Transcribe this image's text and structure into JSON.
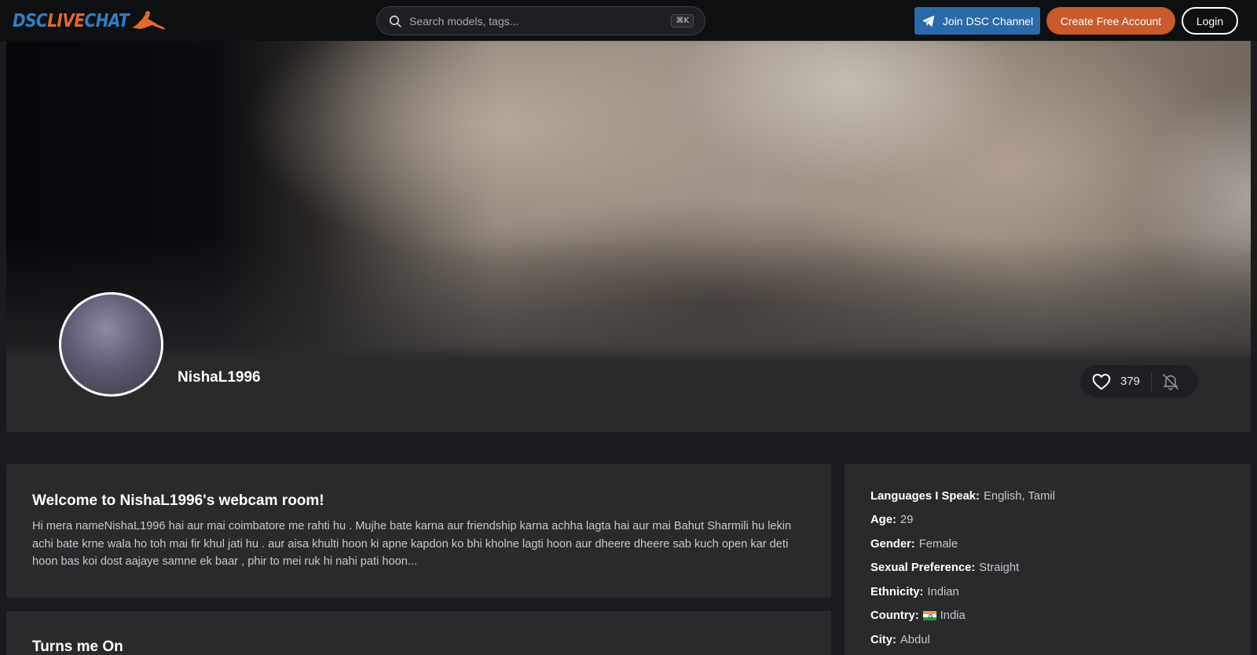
{
  "header": {
    "logo_prefix": "DSC",
    "logo_highlight": "LIVE",
    "logo_suffix": "CHAT",
    "search": {
      "placeholder": "Search models, tags...",
      "shortcut": "⌘K"
    },
    "telegram_label": "Join DSC Channel",
    "create_label": "Create Free Account",
    "login_label": "Login"
  },
  "profile": {
    "username": "NishaL1996",
    "likes": "379"
  },
  "about": {
    "title": "Welcome to NishaL1996's webcam room!",
    "text": "Hi mera nameNishaL1996 hai aur mai coimbatore me rahti hu . Mujhe bate karna aur friendship karna achha lagta hai aur mai Bahut Sharmili hu lekin achi bate krne wala ho toh mai fir khul jati hu . aur aisa khulti hoon ki apne kapdon ko bhi kholne lagti hoon aur dheere dheere sab kuch open kar deti hoon bas koi dost aajaye samne ek baar , phir to mei ruk hi nahi pati hoon..."
  },
  "turns_on": {
    "title": "Turns me On"
  },
  "info": [
    {
      "key": "Languages I Speak:",
      "value": "English, Tamil"
    },
    {
      "key": "Age:",
      "value": "29"
    },
    {
      "key": "Gender:",
      "value": "Female"
    },
    {
      "key": "Sexual Preference:",
      "value": "Straight"
    },
    {
      "key": "Ethnicity:",
      "value": "Indian"
    },
    {
      "key": "Country:",
      "value": "India",
      "flag": "india-flag-icon"
    },
    {
      "key": "City:",
      "value": "Abdul"
    }
  ],
  "colors": {
    "brand_blue": "#2f7fc6",
    "brand_orange": "#e06a2c",
    "telegram_button": "#2b6aa8",
    "create_button": "#c85a2c",
    "page_bg": "#1a1b1e",
    "card_bg": "#2a2a2d"
  }
}
